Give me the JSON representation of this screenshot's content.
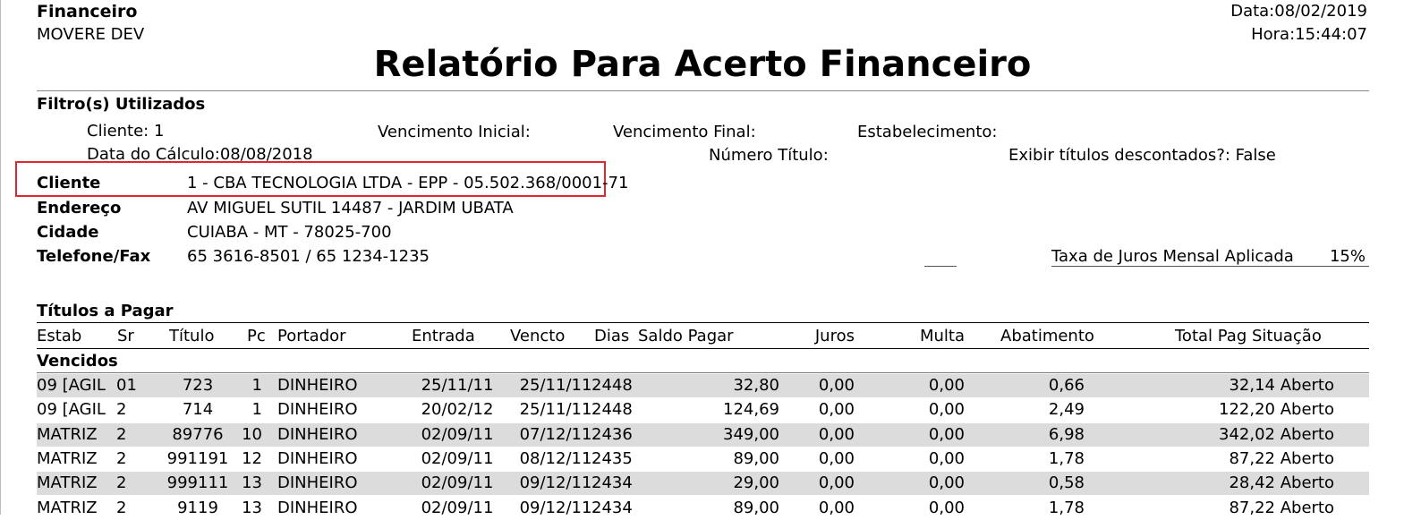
{
  "header": {
    "module": "Financeiro",
    "company": "MOVERE DEV",
    "date": "Data:08/02/2019",
    "time": "Hora:15:44:07",
    "title": "Relatório Para Acerto Financeiro"
  },
  "filters": {
    "heading": "Filtro(s) Utilizados",
    "cliente": "Cliente: 1",
    "venc_inicial": "Vencimento Inicial:",
    "venc_final": "Vencimento Final:",
    "estabelecimento": "Estabelecimento:",
    "data_calculo": "Data do Cálculo:08/08/2018",
    "numero_titulo": "Número Título:",
    "exibir_descontados": "Exibir títulos descontados?: False"
  },
  "client": {
    "cliente_label": "Cliente",
    "cliente_value": "1 - CBA TECNOLOGIA LTDA - EPP - 05.502.368/0001-71",
    "endereco_label": "Endereço",
    "endereco_value": "AV MIGUEL SUTIL 14487 - JARDIM UBATA",
    "cidade_label": "Cidade",
    "cidade_value": "CUIABA - MT - 78025-700",
    "telefone_label": "Telefone/Fax",
    "telefone_value": "65 3616-8501 / 65 1234-1235",
    "taxa_label": "Taxa de Juros Mensal Aplicada",
    "taxa_value": "15%"
  },
  "section": {
    "title": "Títulos a Pagar",
    "group": "Vencidos"
  },
  "table": {
    "columns": {
      "estab": "Estab",
      "sr": "Sr",
      "titulo": "Título",
      "pc": "Pc",
      "portador": "Portador",
      "entrada": "Entrada",
      "vencto": "Vencto",
      "dias": "Dias",
      "saldo": "Saldo Pagar",
      "juros": "Juros",
      "multa": "Multa",
      "abat": "Abatimento",
      "total": "Total Pag Situação"
    },
    "rows": [
      {
        "estab": "09 [AGIL",
        "sr": "01",
        "titulo": "723",
        "pc": "1",
        "portador": "DINHEIRO",
        "entrada": "25/11/11",
        "vencto": "25/11/11",
        "dias": "2448",
        "saldo": "32,80",
        "juros": "0,00",
        "multa": "0,00",
        "abat": "0,66",
        "total": "32,14 Aberto"
      },
      {
        "estab": "09 [AGIL",
        "sr": "2",
        "titulo": "714",
        "pc": "1",
        "portador": "DINHEIRO",
        "entrada": "20/02/12",
        "vencto": "25/11/11",
        "dias": "2448",
        "saldo": "124,69",
        "juros": "0,00",
        "multa": "0,00",
        "abat": "2,49",
        "total": "122,20 Aberto"
      },
      {
        "estab": "MATRIZ",
        "sr": "2",
        "titulo": "89776",
        "pc": "10",
        "portador": "DINHEIRO",
        "entrada": "02/09/11",
        "vencto": "07/12/11",
        "dias": "2436",
        "saldo": "349,00",
        "juros": "0,00",
        "multa": "0,00",
        "abat": "6,98",
        "total": "342,02 Aberto"
      },
      {
        "estab": "MATRIZ",
        "sr": "2",
        "titulo": "991191",
        "pc": "12",
        "portador": "DINHEIRO",
        "entrada": "02/09/11",
        "vencto": "08/12/11",
        "dias": "2435",
        "saldo": "89,00",
        "juros": "0,00",
        "multa": "0,00",
        "abat": "1,78",
        "total": "87,22 Aberto"
      },
      {
        "estab": "MATRIZ",
        "sr": "2",
        "titulo": "999111",
        "pc": "13",
        "portador": "DINHEIRO",
        "entrada": "02/09/11",
        "vencto": "09/12/11",
        "dias": "2434",
        "saldo": "29,00",
        "juros": "0,00",
        "multa": "0,00",
        "abat": "0,58",
        "total": "28,42 Aberto"
      },
      {
        "estab": "MATRIZ",
        "sr": "2",
        "titulo": "9119",
        "pc": "13",
        "portador": "DINHEIRO",
        "entrada": "02/09/11",
        "vencto": "09/12/11",
        "dias": "2434",
        "saldo": "89,00",
        "juros": "0,00",
        "multa": "0,00",
        "abat": "1,78",
        "total": "87,22 Aberto"
      }
    ]
  }
}
